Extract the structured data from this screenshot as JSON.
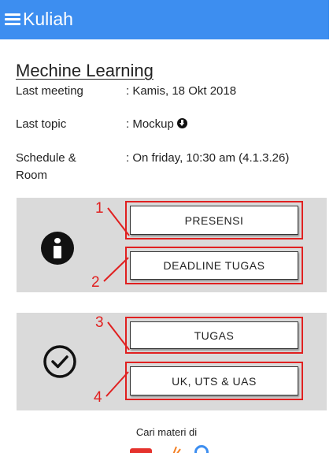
{
  "app_bar": {
    "title": "Kuliah",
    "color": "#3d8ef0"
  },
  "course": {
    "title": "Mechine Learning",
    "details": [
      {
        "label": "Last meeting",
        "value": ": Kamis, 18 Okt 2018"
      },
      {
        "label": "Last topic",
        "value": ": Mockup"
      },
      {
        "label": "Schedule & Room",
        "value": ": On friday, 10:30 am (4.1.3.26)"
      }
    ]
  },
  "panel_info": {
    "icon": "info-icon",
    "buttons": [
      {
        "number": "1",
        "label": "PRESENSI"
      },
      {
        "number": "2",
        "label": "DEADLINE TUGAS"
      }
    ]
  },
  "panel_tasks": {
    "icon": "check-circle-icon",
    "buttons": [
      {
        "number": "3",
        "label": "TUGAS"
      },
      {
        "number": "4",
        "label": "UK, UTS & UAS"
      }
    ]
  },
  "footer": {
    "text": "Cari materi di",
    "icons": [
      "youtube-icon",
      "stackoverflow-icon",
      "google-icon"
    ]
  },
  "colors": {
    "highlight": "#e02020",
    "panel": "#dadada"
  }
}
